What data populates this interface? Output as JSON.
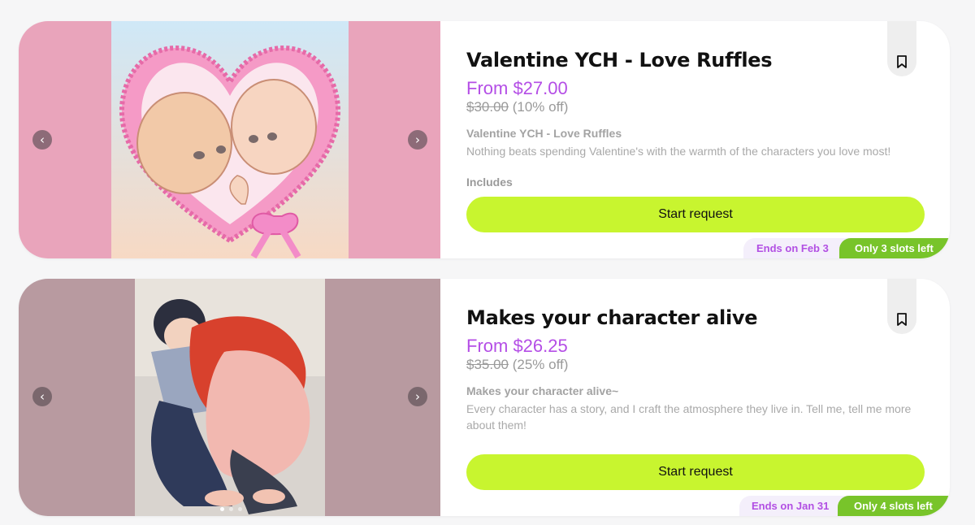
{
  "listings": [
    {
      "title": "Valentine YCH - Love Ruffles",
      "price": "From $27.00",
      "old_price": "$30.00",
      "discount": "(10% off)",
      "subtitle": "Valentine YCH - Love Ruffles",
      "description": "Nothing beats spending Valentine's with the warmth of the characters you love most!",
      "includes_label": "Includes",
      "button_label": "Start request",
      "ends_label": "Ends on Feb 3",
      "slots_label": "Only 3 slots left",
      "prev_arrow": "‹",
      "next_arrow": "›"
    },
    {
      "title": "Makes your character alive",
      "price": "From $26.25",
      "old_price": "$35.00",
      "discount": "(25% off)",
      "subtitle": "Makes your character alive~",
      "description": "Every character has a story, and I craft the atmosphere they live in. Tell me, tell me more about them!",
      "button_label": "Start request",
      "ends_label": "Ends on Jan 31",
      "slots_label": "Only 4 slots left",
      "prev_arrow": "‹",
      "next_arrow": "›",
      "gallery_dots": 3,
      "active_dot": 0
    }
  ],
  "colors": {
    "accent_purple": "#b44ee6",
    "button_lime": "#c8f52f",
    "slots_green": "#78c42a",
    "card1_bg": "#e9a4bb",
    "card2_bg": "#b89aa0"
  },
  "icons": {
    "bookmark": "bookmark-icon",
    "prev": "chevron-left-icon",
    "next": "chevron-right-icon"
  }
}
